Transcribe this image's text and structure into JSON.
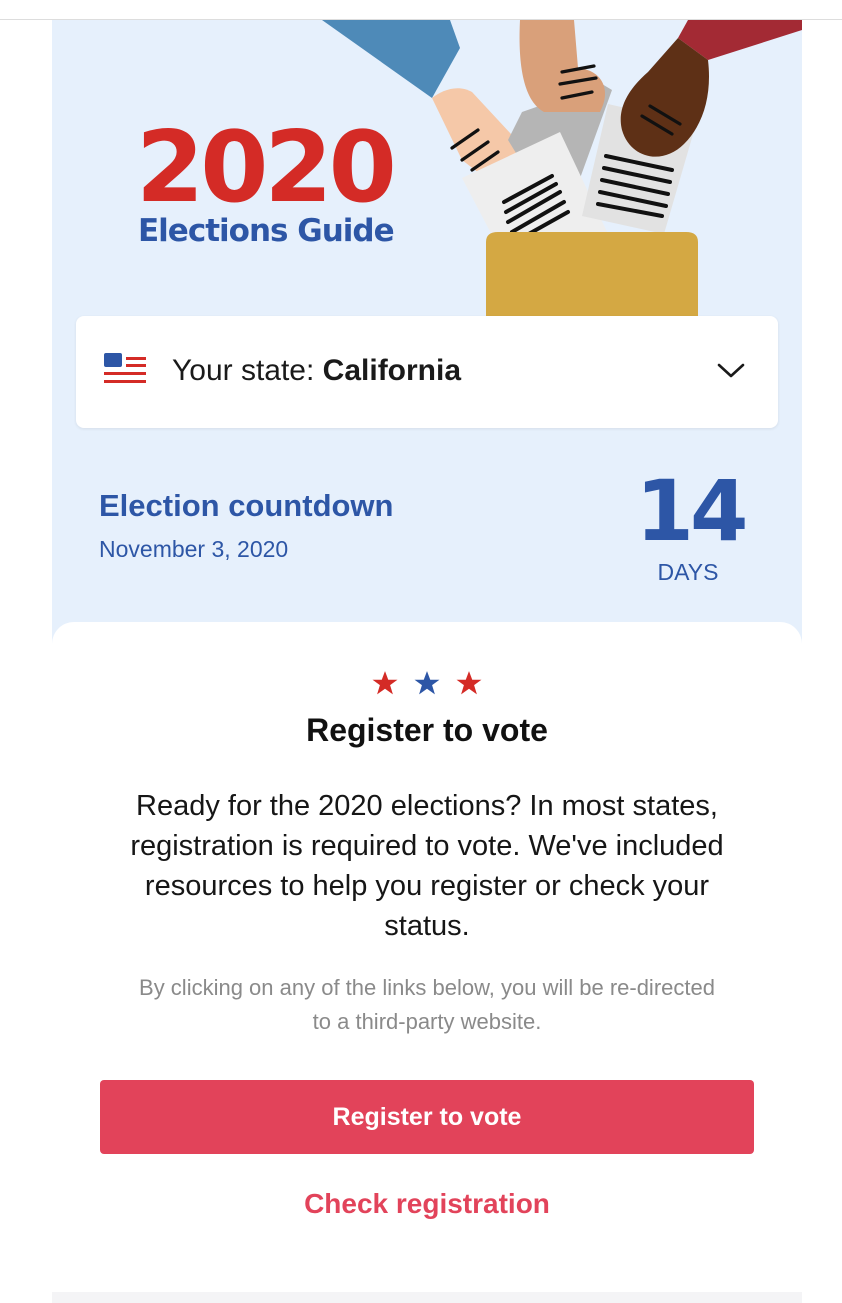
{
  "hero": {
    "year": "2020",
    "subtitle": "Elections Guide",
    "illustration_icon": "ballot-box-hands-illustration"
  },
  "state_selector": {
    "label": "Your state: ",
    "value": "California",
    "flag_icon": "us-flag-icon",
    "chevron_icon": "chevron-down-icon"
  },
  "countdown": {
    "label": "Election countdown",
    "date": "November 3, 2020",
    "number": "14",
    "unit": "DAYS"
  },
  "register": {
    "stars": [
      "star-icon",
      "star-icon",
      "star-icon"
    ],
    "title": "Register to vote",
    "body": "Ready for the 2020 elections? In most states, registration is required to vote. We've included resources to help you register or check your status.",
    "note": "By clicking on any of the links below, you will be re-directed to a third-party website.",
    "primary_button": "Register to vote",
    "secondary_link": "Check registration"
  },
  "colors": {
    "brand_red": "#d42b26",
    "brand_blue": "#2d56a6",
    "panel_bg": "#e6f0fc",
    "button_red": "#e2435a",
    "ballot_box": "#d4a843"
  }
}
